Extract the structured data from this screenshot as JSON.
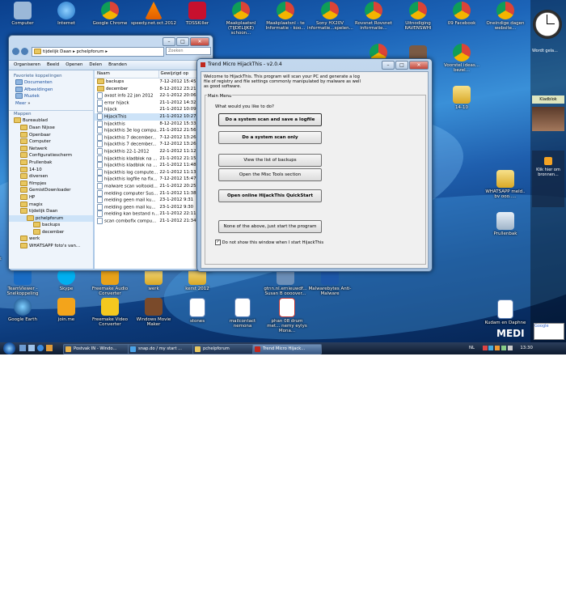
{
  "desktop": {
    "top_icons": [
      "Computer",
      "Internet",
      "Google Chrome",
      "speedy.net.oct.2012",
      "TDSSKiller",
      "Maakplaatsnl (TIJDELIJKE) schoon...",
      "Maakplaatsnl - te Informatie - koo...",
      "Sony HX20V informatie...spelen...",
      "Rovsnet Rovsnet informatie...",
      "Uitnodiging RAVENSWHI",
      "09 Facebook",
      "Oneindige dagen website..."
    ],
    "mid_left_icons": [
      "TeamViewer - Snelkoppeling",
      "Skype",
      "Freemake Audio Converter",
      "werk",
      "kerst 2012",
      "gtnn.nl.ernieuwdf... Susan B oooover...",
      "Malwarebytes Anti-Malware"
    ],
    "bottom_icons": [
      "Google Earth",
      "join.me",
      "Freemake Video Converter",
      "Windows Movie Maker",
      "stones",
      "mailcontact nemona",
      "phan 08 drum met... nemy eylys Mona..."
    ],
    "right_icons": [
      "Voorstel ideas... bezel...",
      "14-10",
      "WHATSAPP meld.. bv ooo.....",
      "Prullenbak",
      "Kudam en Daphne"
    ],
    "edge_icons": [
      "Wi",
      "werk"
    ]
  },
  "gadgets": {
    "clock_label": "Wordt gela...",
    "photo_label": "Kladblok",
    "feed_text": "Klik hier om bronnen...",
    "google_label": "Google"
  },
  "explorer": {
    "breadcrumb": [
      "tijdelijk Daan",
      "pchelpforum"
    ],
    "search_placeholder": "Zoeken",
    "toolbar": [
      "Organiseren",
      "Beeld",
      "Openen",
      "Delen",
      "Branden"
    ],
    "favorites_header": "Favoriete koppelingen",
    "favorites": [
      "Documenten",
      "Afbeeldingen",
      "Muziek"
    ],
    "more_label": "Meer",
    "folders_header": "Mappen",
    "tree": [
      "Bureaublad",
      "Daan Nijsse",
      "Openbaar",
      "Computer",
      "Netwerk",
      "Configuratiescherm",
      "Prullenbak",
      "14-10",
      "diversen",
      "filmpjes",
      "GemistDownloader",
      "HP",
      "magix",
      "tijdelijk Daan",
      "pchelpforum",
      "backups",
      "december",
      "werk",
      "WHATSAPP foto's van..."
    ],
    "columns": [
      "Naam",
      "Gewijzigd op"
    ],
    "files": [
      {
        "name": "backups",
        "date": "7-12-2012 15:45"
      },
      {
        "name": "december",
        "date": "8-12-2012 23:21"
      },
      {
        "name": "avast info 22 jan 2012",
        "date": "22-1-2012 20:06"
      },
      {
        "name": "error hijack",
        "date": "21-1-2012 14:32"
      },
      {
        "name": "hijack",
        "date": "21-1-2012 10:09"
      },
      {
        "name": "HijackThis",
        "date": "21-1-2012 10:27"
      },
      {
        "name": "hijackthis",
        "date": "8-12-2012 15:33"
      },
      {
        "name": "hijackthis 3e log compu...",
        "date": "21-1-2012 21:56"
      },
      {
        "name": "hijackthis 7 december...",
        "date": "7-12-2012 13:26"
      },
      {
        "name": "hijackthis 7 december...",
        "date": "7-12-2012 13:26"
      },
      {
        "name": "hijackthis 22-1-2012",
        "date": "22-1-2012 11:12"
      },
      {
        "name": "hijackthis kladblok na ...",
        "date": "21-1-2012 21:15"
      },
      {
        "name": "hijackthis kladblok na ...",
        "date": "21-1-2012 11:48"
      },
      {
        "name": "hijackthis log compute...",
        "date": "22-1-2012 11:13"
      },
      {
        "name": "hijackthis logfile na fix...",
        "date": "7-12-2012 15:47"
      },
      {
        "name": "malware scan voltooid...",
        "date": "21-1-2012 20:25"
      },
      {
        "name": "melding computer Sus...",
        "date": "21-1-2012 11:38"
      },
      {
        "name": "melding geen mail ku...",
        "date": "23-1-2012 9:31"
      },
      {
        "name": "melding geen mail ku...",
        "date": "23-1-2012 9:30"
      },
      {
        "name": "melding kan bestand n...",
        "date": "21-1-2012 22:11"
      },
      {
        "name": "scan combofix compu...",
        "date": "21-1-2012 21:34"
      }
    ]
  },
  "hijackthis": {
    "title": "Trend Micro HijackThis - v2.0.4",
    "welcome": "Welcome to HijackThis. This program will scan your PC and generate a log file of registry and file settings commonly manipulated by malware as well as good software.",
    "group_label": "Main Menu",
    "question": "What would you like to do?",
    "buttons": [
      "Do a system scan and save a logfile",
      "Do a system scan only",
      "View the list of backups",
      "Open the Misc Tools section",
      "Open online HijackThis QuickStart",
      "None of the above, just start the program"
    ],
    "checkbox_label": "Do not show this window when I start HijackThis"
  },
  "taskbar": {
    "tasks": [
      "Postvak IN - Windo...",
      "snap.do / my start ...",
      "pchelpforum",
      "Trend Micro Hijack..."
    ],
    "language": "NL",
    "time": "13:30"
  }
}
